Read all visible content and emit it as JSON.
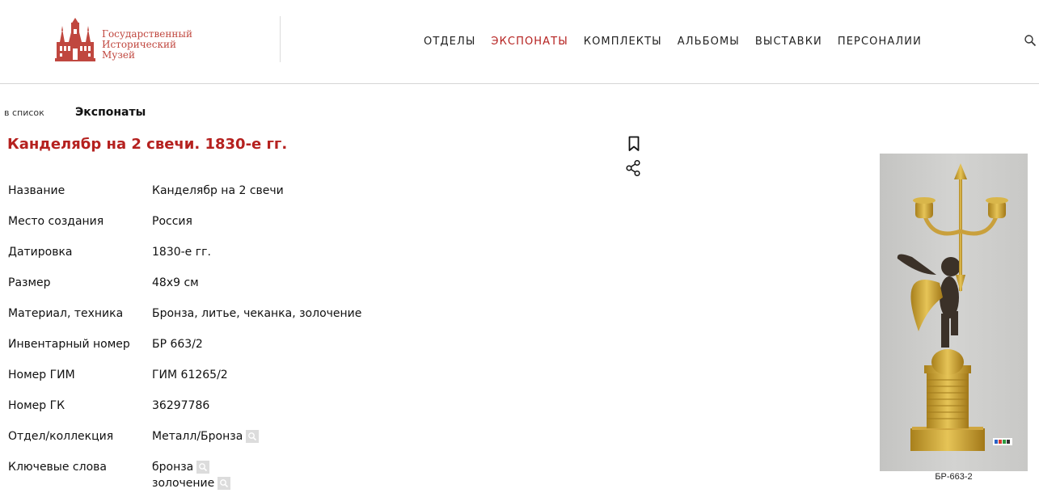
{
  "header": {
    "logo": {
      "lines": [
        "Государственный",
        "Исторический",
        "Музей"
      ],
      "color": "#c0473f"
    },
    "nav": [
      {
        "label": "ОТДЕЛЫ",
        "active": false
      },
      {
        "label": "ЭКСПОНАТЫ",
        "active": true
      },
      {
        "label": "КОМПЛЕКТЫ",
        "active": false
      },
      {
        "label": "АЛЬБОМЫ",
        "active": false
      },
      {
        "label": "ВЫСТАВКИ",
        "active": false
      },
      {
        "label": "ПЕРСОНАЛИИ",
        "active": false
      }
    ],
    "search_icon": "search-icon"
  },
  "breadcrumb": {
    "back_label": "в список",
    "current": "Экспонаты"
  },
  "title": "Канделябр на 2 свечи. 1830-е гг.",
  "accent_color": "#b5211f",
  "actions": {
    "bookmark_icon": "bookmark-icon",
    "share_icon": "share-icon"
  },
  "properties": [
    {
      "label": "Название",
      "values": [
        "Канделябр на 2 свечи"
      ],
      "searchable": false
    },
    {
      "label": "Место создания",
      "values": [
        "Россия"
      ],
      "searchable": false
    },
    {
      "label": "Датировка",
      "values": [
        "1830-е гг."
      ],
      "searchable": false
    },
    {
      "label": "Размер",
      "values": [
        "48x9 см"
      ],
      "searchable": false
    },
    {
      "label": "Материал, техника",
      "values": [
        "Бронза, литье, чеканка, золочение"
      ],
      "searchable": false
    },
    {
      "label": "Инвентарный номер",
      "values": [
        "БР 663/2"
      ],
      "searchable": false
    },
    {
      "label": "Номер ГИМ",
      "values": [
        "ГИМ 61265/2"
      ],
      "searchable": false
    },
    {
      "label": "Номер ГК",
      "values": [
        "36297786"
      ],
      "searchable": false
    },
    {
      "label": "Отдел/коллекция",
      "values": [
        "Металл/Бронза"
      ],
      "searchable": true
    },
    {
      "label": "Ключевые слова",
      "values": [
        "бронза",
        "золочение"
      ],
      "searchable": true
    }
  ],
  "image": {
    "caption": "БР-663-2"
  }
}
